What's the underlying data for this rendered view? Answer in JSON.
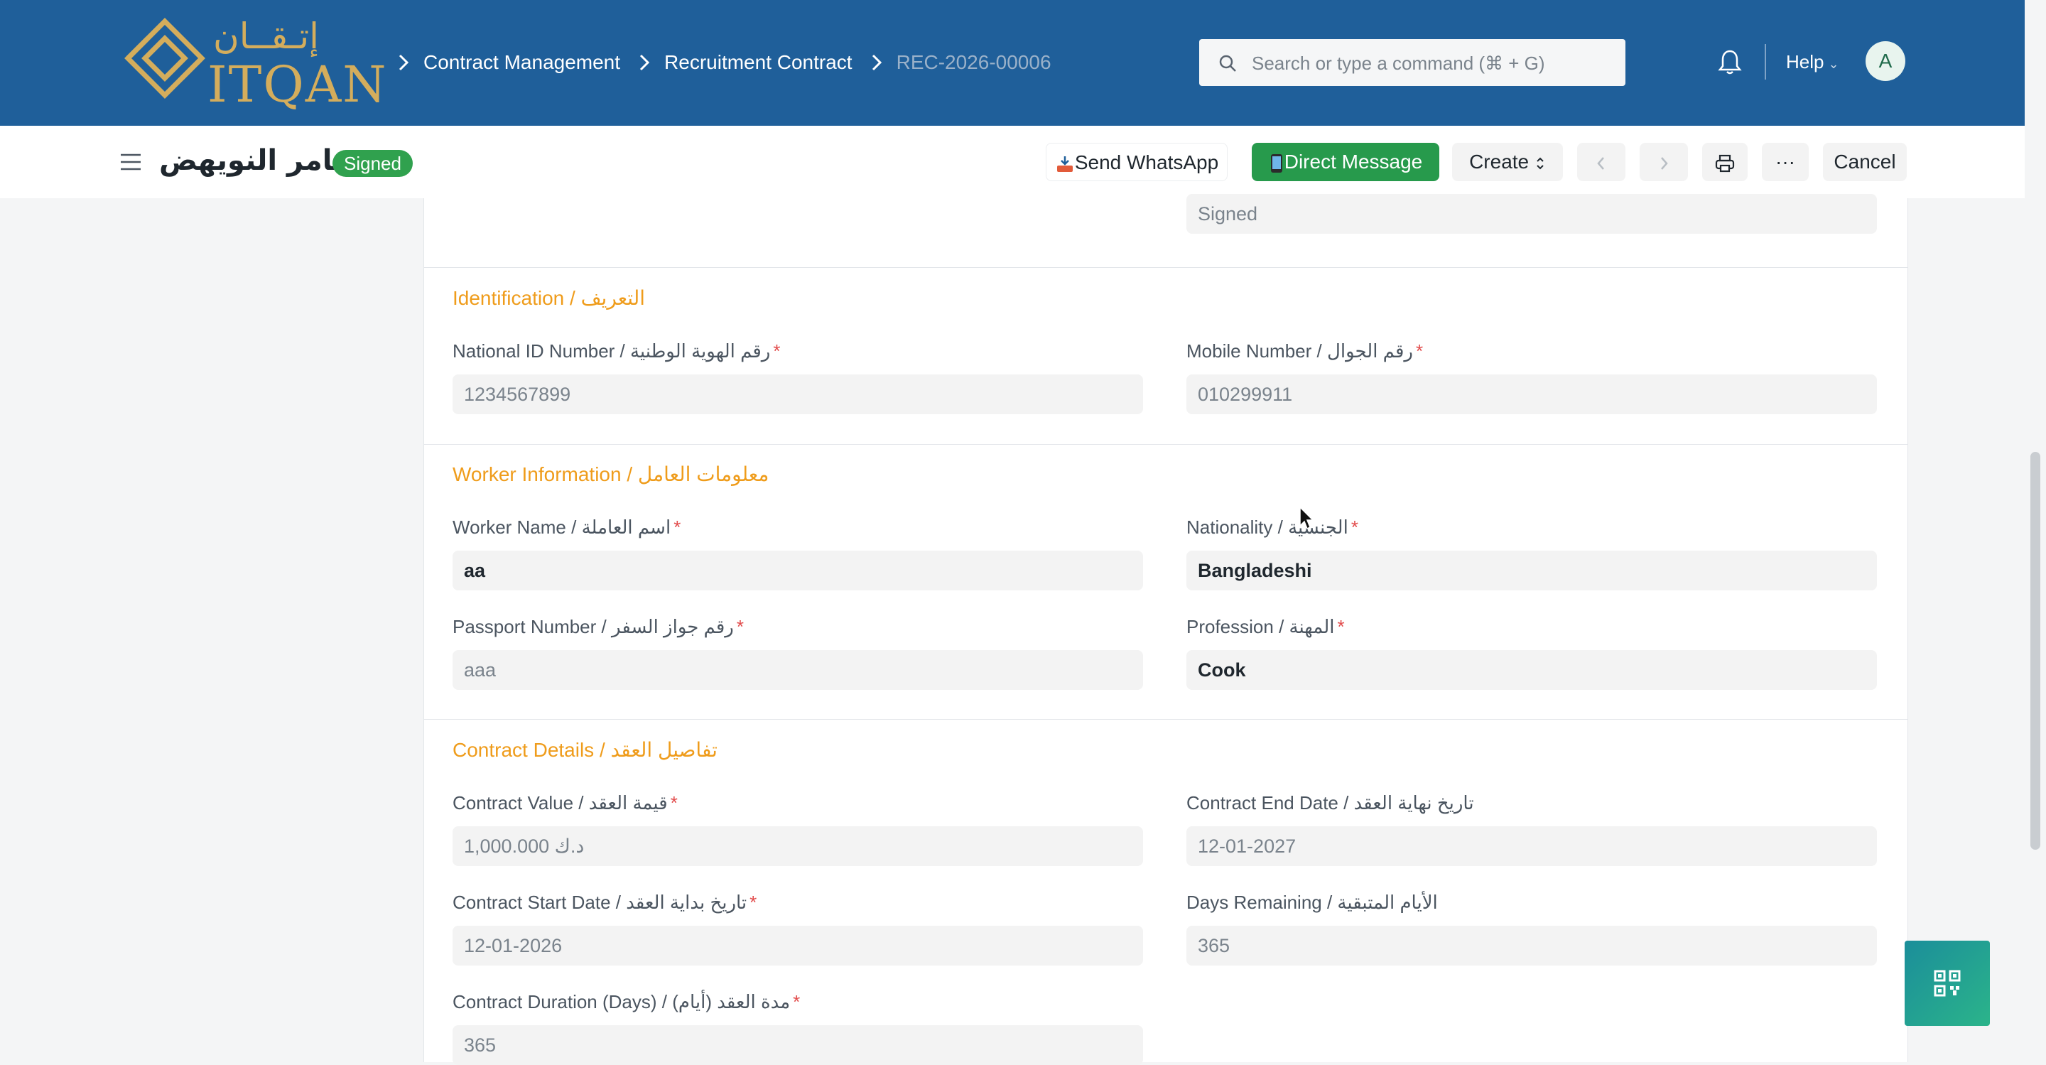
{
  "brand": {
    "latin": "ITQAN",
    "arabic": "إتـقــان"
  },
  "breadcrumb": [
    "Contract Management",
    "Recruitment Contract",
    "REC-2026-00006"
  ],
  "search": {
    "placeholder": "Search or type a command (⌘ + G)"
  },
  "navbar": {
    "help": "Help",
    "avatar": "A"
  },
  "doc": {
    "title": "ثامر النويهض",
    "status": "Signed"
  },
  "toolbar": {
    "send_whatsapp": "Send WhatsApp",
    "direct_message": "Direct Message",
    "create": "Create",
    "more": "···",
    "cancel": "Cancel"
  },
  "top_field": {
    "value": "Signed"
  },
  "sections": {
    "identification": {
      "title": "Identification / التعريف",
      "national_id": {
        "label": "National ID Number / رقم الهوية الوطنية",
        "value": "1234567899"
      },
      "mobile": {
        "label": "Mobile Number / رقم الجوال",
        "value": "010299911"
      }
    },
    "worker": {
      "title": "Worker Information / معلومات العامل",
      "worker_name": {
        "label": "Worker Name / اسم العاملة",
        "value": "aa"
      },
      "nationality": {
        "label": "Nationality / الجنسية",
        "value": "Bangladeshi"
      },
      "passport": {
        "label": "Passport Number / رقم جواز السفر",
        "value": "aaa"
      },
      "profession": {
        "label": "Profession / المهنة",
        "value": "Cook"
      }
    },
    "contract": {
      "title": "Contract Details / تفاصيل العقد",
      "value": {
        "label": "Contract Value / قيمة العقد",
        "value": "د.ك 1,000.000"
      },
      "end_date": {
        "label": "Contract End Date / تاريخ نهاية العقد",
        "value": "12-01-2027"
      },
      "start_date": {
        "label": "Contract Start Date / تاريخ بداية العقد",
        "value": "12-01-2026"
      },
      "days_remaining": {
        "label": "Days Remaining / الأيام المتبقية",
        "value": "365"
      },
      "duration": {
        "label": "Contract Duration (Days) / (أيام) مدة العقد",
        "value": "365"
      }
    }
  },
  "colors": {
    "navbar": "#1f5f9a",
    "brand_gold": "#d4ad5c",
    "status_green": "#30a14e",
    "section_orange": "#ef9c1b",
    "required_red": "#e24c4c"
  }
}
